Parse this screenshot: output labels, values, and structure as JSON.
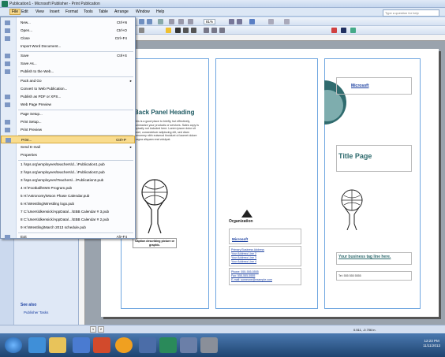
{
  "window": {
    "title": "Publication1 - Microsoft Publisher - Print Publication"
  },
  "question_box": {
    "placeholder": "Type a question for help"
  },
  "menubar": [
    "File",
    "Edit",
    "View",
    "Insert",
    "Format",
    "Tools",
    "Table",
    "Arrange",
    "Window",
    "Help"
  ],
  "zoom": "81%",
  "file_menu": {
    "items": [
      {
        "label": "New...",
        "shortcut": "Ctrl+N",
        "icon": "new-doc-icon"
      },
      {
        "label": "Open...",
        "shortcut": "Ctrl+O",
        "icon": "open-folder-icon"
      },
      {
        "label": "Close",
        "shortcut": "Ctrl+F4",
        "icon": "close-doc-icon"
      },
      {
        "label": "Import Word Document...",
        "shortcut": "",
        "icon": ""
      },
      {
        "label": "Save",
        "shortcut": "Ctrl+S",
        "icon": "save-icon"
      },
      {
        "label": "Save As...",
        "shortcut": "",
        "icon": "save-as-icon"
      },
      {
        "label": "Publish to the Web...",
        "shortcut": "",
        "icon": "web-icon"
      },
      {
        "label": "Pack and Go",
        "shortcut": "",
        "icon": "",
        "submenu": true
      },
      {
        "label": "Convert to Web Publication...",
        "shortcut": "",
        "icon": ""
      },
      {
        "label": "Publish as PDF or XPS...",
        "shortcut": "",
        "icon": "pdf-icon"
      },
      {
        "label": "Web Page Preview",
        "shortcut": "",
        "icon": "web-preview-icon"
      },
      {
        "label": "Page Setup...",
        "shortcut": "",
        "icon": ""
      },
      {
        "label": "Print Setup...",
        "shortcut": "",
        "icon": "print-setup-icon"
      },
      {
        "label": "Print Preview",
        "shortcut": "",
        "icon": "print-preview-icon"
      },
      {
        "label": "Print...",
        "shortcut": "Ctrl+P",
        "icon": "print-icon",
        "highlight": true
      },
      {
        "label": "Send E-mail",
        "shortcut": "",
        "icon": "",
        "submenu": true
      },
      {
        "label": "Properties",
        "shortcut": "",
        "icon": ""
      },
      {
        "label": "1 \\\\sps.org\\employees\\teachers\\d...\\Publication1.pub",
        "shortcut": "",
        "icon": ""
      },
      {
        "label": "2 \\\\sps.org\\employees\\teachers\\d...\\Publication2.pub",
        "shortcut": "",
        "icon": ""
      },
      {
        "label": "3 \\\\sps.org\\employees\\Teachers\\...\\Publication2.pub",
        "shortcut": "",
        "icon": ""
      },
      {
        "label": "4 H:\\Football\\KMS Program.pub",
        "shortcut": "",
        "icon": ""
      },
      {
        "label": "5 H:\\Astronomy\\Moon Phase Calendar.pub",
        "shortcut": "",
        "icon": ""
      },
      {
        "label": "6 H:\\Wrestling\\Wrestling logo.pub",
        "shortcut": "",
        "icon": ""
      },
      {
        "label": "7 C:\\Users\\dkensick\\AppData\\...\\EBB Calendar # 3.pub",
        "shortcut": "",
        "icon": ""
      },
      {
        "label": "8 C:\\Users\\dkensick\\AppData\\...\\EBB Calendar # 2.pub",
        "shortcut": "",
        "icon": ""
      },
      {
        "label": "9 H:\\Wrestling\\March 2013 schedule.pub",
        "shortcut": "",
        "icon": ""
      },
      {
        "label": "Exit",
        "shortcut": "Alt+F4",
        "icon": "exit-icon"
      }
    ]
  },
  "taskpane": {
    "see_also": "See also",
    "publisher_tasks": "Publisher Tasks"
  },
  "panel1": {
    "heading": "Back Panel Heading",
    "body": "This is a good place to briefly, but effectively, summarize your products or services. Sales copy is typically not included here. Lorem ipsum dolor sit amet, consectetuer adipiscing elit, sed diam nonummy nibh euismod tincidunt ut laoreet dolore magna aliquam erat volutpat.",
    "caption": "Caption describing picture or graphic."
  },
  "panel2": {
    "organization": "Organization",
    "company": "Microsoft",
    "address": [
      "Primary Business Address",
      "Your Address Line 2",
      "Your Address Line 3",
      "Your Address Line 4"
    ],
    "phone": "Phone: 555-555-5555",
    "fax": "Fax: 555-555-5555",
    "email": "E-mail: someone@example.com"
  },
  "panel3": {
    "company": "Microsoft",
    "title": "Title Page",
    "tagline": "Your business tag line here.",
    "tel": "Tel: 555 555 5555"
  },
  "status": {
    "coords": "0.511, -0.706 in."
  },
  "page_tabs": [
    "1",
    "2"
  ],
  "clock": {
    "time": "12:23 PM",
    "date": "11/11/2013"
  }
}
